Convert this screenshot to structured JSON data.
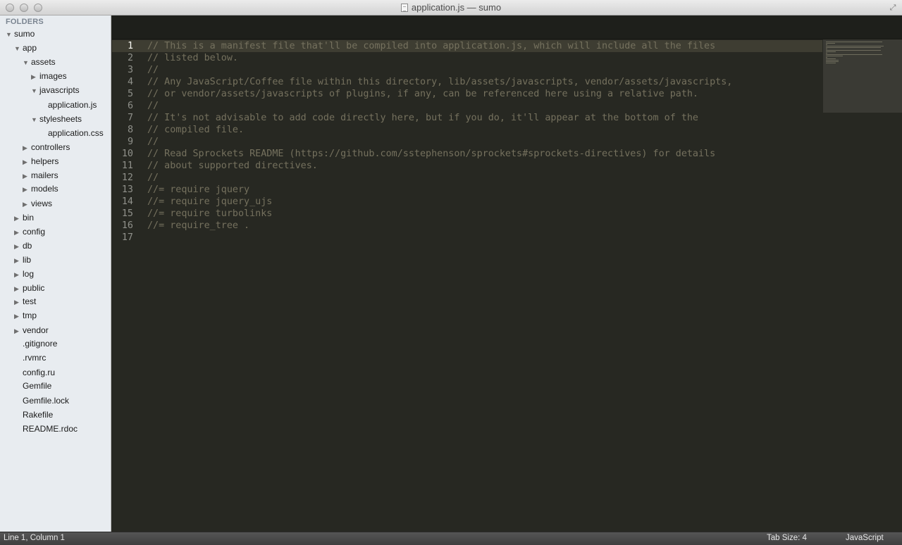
{
  "window": {
    "title": "application.js — sumo"
  },
  "sidebar": {
    "header": "FOLDERS",
    "tree": [
      {
        "label": "sumo",
        "expanded": true
      },
      {
        "label": "app",
        "expanded": true
      },
      {
        "label": "assets",
        "expanded": true
      },
      {
        "label": "images",
        "expanded": false
      },
      {
        "label": "javascripts",
        "expanded": true
      },
      {
        "label": "application.js"
      },
      {
        "label": "stylesheets",
        "expanded": true
      },
      {
        "label": "application.css"
      },
      {
        "label": "controllers",
        "expanded": false
      },
      {
        "label": "helpers",
        "expanded": false
      },
      {
        "label": "mailers",
        "expanded": false
      },
      {
        "label": "models",
        "expanded": false
      },
      {
        "label": "views",
        "expanded": false
      },
      {
        "label": "bin",
        "expanded": false
      },
      {
        "label": "config",
        "expanded": false
      },
      {
        "label": "db",
        "expanded": false
      },
      {
        "label": "lib",
        "expanded": false
      },
      {
        "label": "log",
        "expanded": false
      },
      {
        "label": "public",
        "expanded": false
      },
      {
        "label": "test",
        "expanded": false
      },
      {
        "label": "tmp",
        "expanded": false
      },
      {
        "label": "vendor",
        "expanded": false
      },
      {
        "label": ".gitignore"
      },
      {
        "label": ".rvmrc"
      },
      {
        "label": "config.ru"
      },
      {
        "label": "Gemfile"
      },
      {
        "label": "Gemfile.lock"
      },
      {
        "label": "Rakefile"
      },
      {
        "label": "README.rdoc"
      }
    ]
  },
  "editor": {
    "active_line": 1,
    "line_numbers": [
      "1",
      "2",
      "3",
      "4",
      "5",
      "6",
      "7",
      "8",
      "9",
      "10",
      "11",
      "12",
      "13",
      "14",
      "15",
      "16",
      "17"
    ],
    "lines": [
      "// This is a manifest file that'll be compiled into application.js, which will include all the files",
      "// listed below.",
      "//",
      "// Any JavaScript/Coffee file within this directory, lib/assets/javascripts, vendor/assets/javascripts,",
      "// or vendor/assets/javascripts of plugins, if any, can be referenced here using a relative path.",
      "//",
      "// It's not advisable to add code directly here, but if you do, it'll appear at the bottom of the",
      "// compiled file.",
      "//",
      "// Read Sprockets README (https://github.com/sstephenson/sprockets#sprockets-directives) for details",
      "// about supported directives.",
      "//",
      "//= require jquery",
      "//= require jquery_ujs",
      "//= require turbolinks",
      "//= require_tree .",
      ""
    ]
  },
  "statusbar": {
    "position": "Line 1, Column 1",
    "tab_size": "Tab Size: 4",
    "syntax": "JavaScript"
  },
  "colors": {
    "editor_bg": "#272822",
    "comment": "#75715e",
    "line_number": "#8f908a",
    "sidebar_bg": "#e8ecf0"
  }
}
